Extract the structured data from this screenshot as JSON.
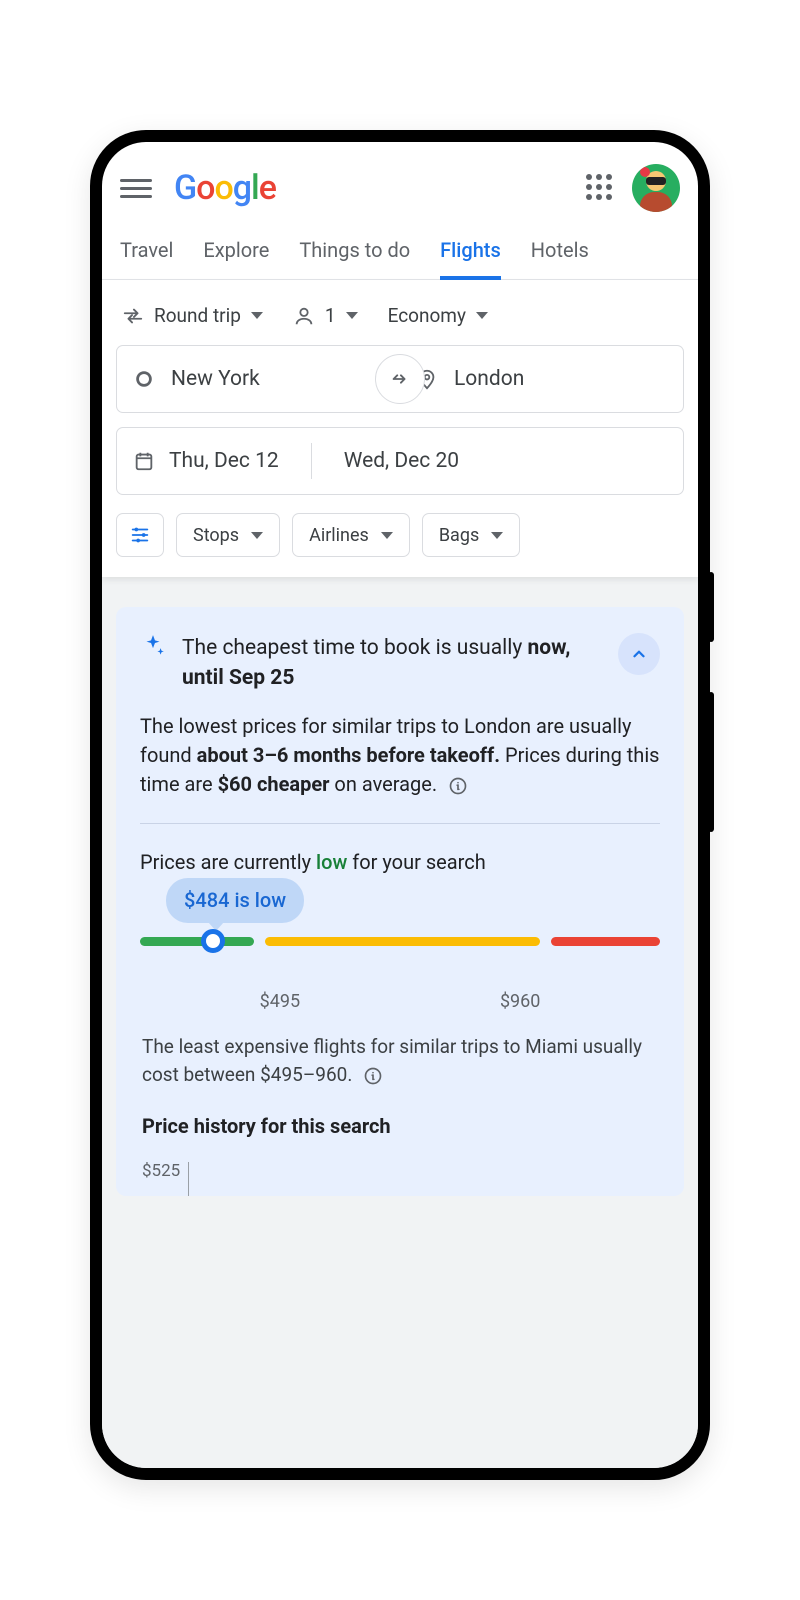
{
  "header": {
    "logo_text": "Google"
  },
  "tabs": {
    "items": [
      "Travel",
      "Explore",
      "Things to do",
      "Flights",
      "Hotels"
    ],
    "active_index": 3
  },
  "search": {
    "trip_type": "Round trip",
    "passengers": "1",
    "cabin": "Economy",
    "from": "New York",
    "to": "London",
    "depart": "Thu, Dec 12",
    "return": "Wed, Dec 20",
    "filter_chips": [
      "Stops",
      "Airlines",
      "Bags"
    ]
  },
  "insight": {
    "title_pre": "The cheapest time to book is usually ",
    "title_bold": "now, until Sep 25",
    "body_pre": "The lowest prices for similar trips to London are usually found ",
    "body_bold1": "about 3–6 months before takeoff.",
    "body_mid": " Prices during this time are ",
    "body_bold2": "$60 cheaper",
    "body_post": " on average.",
    "status_pre": "Prices are currently ",
    "status_word": "low",
    "status_post": " for your search",
    "bubble": "$484 is low",
    "tick_low": "$495",
    "tick_high": "$960",
    "footnote": "The least expensive flights for similar trips to Miami usually cost between $495–960.",
    "history_title": "Price history for this search",
    "history_y0": "$525"
  },
  "colors": {
    "blue": "#1a73e8",
    "green": "#34a853",
    "yellow": "#fbbc04",
    "red": "#ea4335"
  }
}
